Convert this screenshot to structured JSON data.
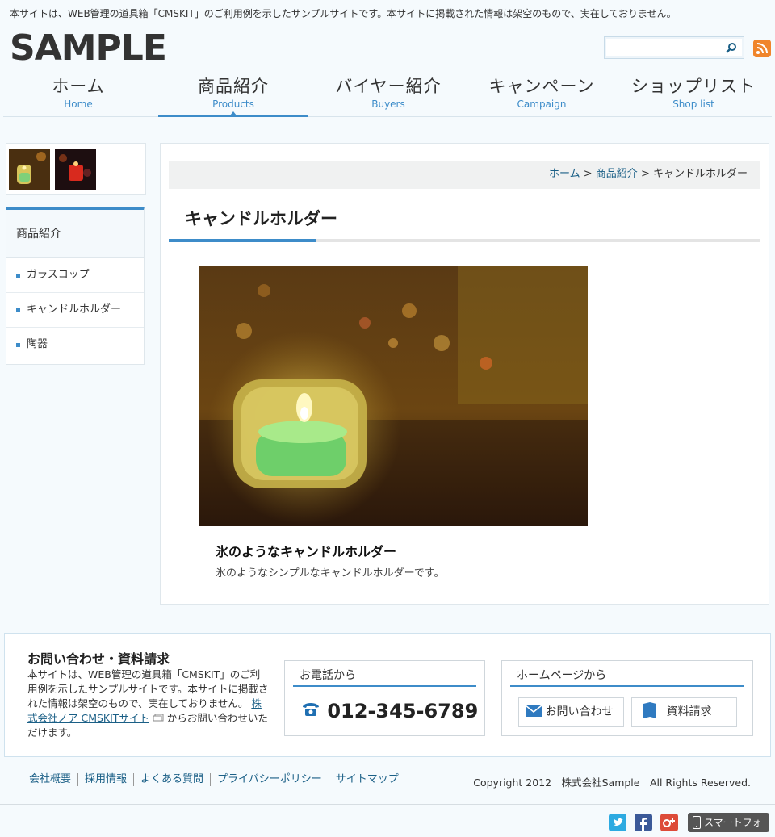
{
  "notice": "本サイトは、WEB管理の道具箱「CMSKIT」のご利用例を示したサンプルサイトです。本サイトに掲載された情報は架空のもので、実在しておりません。",
  "logo": "SAMPLE",
  "search": {
    "value": "",
    "placeholder": ""
  },
  "nav": [
    {
      "jp": "ホーム",
      "en": "Home"
    },
    {
      "jp": "商品紹介",
      "en": "Products"
    },
    {
      "jp": "バイヤー紹介",
      "en": "Buyers"
    },
    {
      "jp": "キャンペーン",
      "en": "Campaign"
    },
    {
      "jp": "ショップリスト",
      "en": "Shop list"
    }
  ],
  "nav_active": "Products",
  "sidebar": {
    "title": "商品紹介",
    "items": [
      "ガラスコップ",
      "キャンドルホルダー",
      "陶器"
    ]
  },
  "breadcrumb": {
    "home": "ホーム",
    "sep": ">",
    "category": "商品紹介",
    "current": "キャンドルホルダー"
  },
  "page_title": "キャンドルホルダー",
  "product": {
    "title": "氷のようなキャンドルホルダー",
    "desc": "氷のようなシンプルなキャンドルホルダーです。"
  },
  "contact": {
    "heading": "お問い合わせ・資料請求",
    "text1": "本サイトは、WEB管理の道具箱「CMSKIT」のご利用例を示したサンプルサイトです。本サイトに掲載された情報は架空のもので、実在しておりません。",
    "link": "株式会社ノア CMSKITサイト",
    "text2": "からお問い合わせいただけます。",
    "phone_heading": "お電話から",
    "phone": "012-345-6789",
    "web_heading": "ホームページから",
    "inquiry_button": "お問い合わせ",
    "document_button": "資料請求"
  },
  "footer_nav": [
    "会社概要",
    "採用情報",
    "よくある質問",
    "プライバシーポリシー",
    "サイトマップ"
  ],
  "copyright": "Copyright 2012　株式会社Sample　All Rights Reserved.",
  "smartphone": "スマートフォン",
  "colors": {
    "accent": "#3d8cc9",
    "rss": "#f0852b",
    "twitter": "#2daae1",
    "facebook": "#3b5998",
    "google": "#dd4b39"
  }
}
